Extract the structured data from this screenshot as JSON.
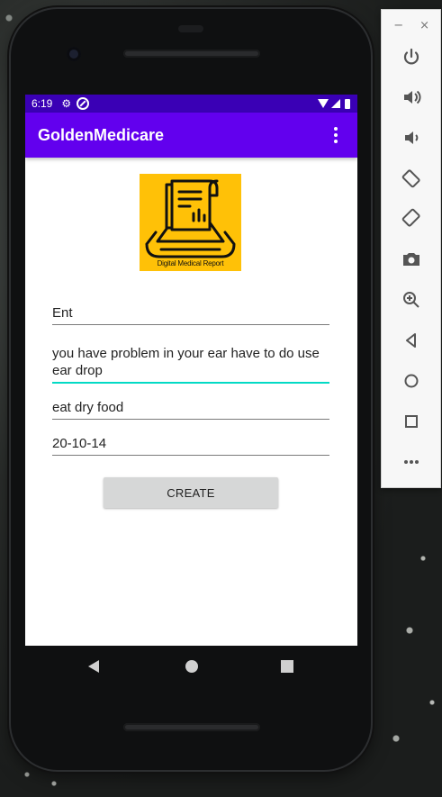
{
  "status_bar": {
    "time": "6:19"
  },
  "app_bar": {
    "title": "GoldenMedicare"
  },
  "logo": {
    "caption": "Digital Medical Report"
  },
  "form": {
    "field_1": "Ent",
    "field_2": "you have problem in your ear have to do use ear drop",
    "field_3": "eat dry food",
    "field_4": "20-10-14",
    "create_label": "CREATE"
  },
  "side_panel": {
    "minimize": "−",
    "close": "×",
    "buttons": [
      "power-icon",
      "volume-up-icon",
      "volume-down-icon",
      "rotate-left-icon",
      "rotate-right-icon",
      "camera-icon",
      "zoom-icon",
      "back-icon",
      "home-icon",
      "overview-icon",
      "more-icon"
    ]
  },
  "colors": {
    "status_bar": "#3a00b5",
    "app_bar": "#6200ee",
    "accent": "#03dac5",
    "logo_bg": "#ffc107"
  }
}
